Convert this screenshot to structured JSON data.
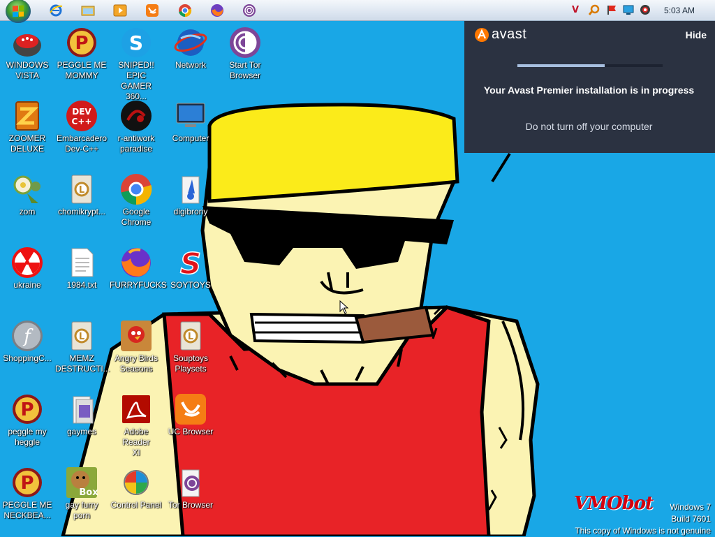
{
  "taskbar": {
    "clock": "5:03 AM",
    "pinned": [
      {
        "name": "internet-explorer-icon"
      },
      {
        "name": "windows-explorer-icon"
      },
      {
        "name": "media-player-icon"
      },
      {
        "name": "uc-browser-icon"
      },
      {
        "name": "chrome-icon"
      },
      {
        "name": "firefox-icon"
      },
      {
        "name": "tor-browser-icon"
      }
    ],
    "tray": [
      {
        "name": "v-tray-icon",
        "glyph": "V"
      },
      {
        "name": "search-tray-icon"
      },
      {
        "name": "flag-tray-icon"
      },
      {
        "name": "monitor-tray-icon"
      },
      {
        "name": "volume-tray-icon"
      }
    ]
  },
  "desktop": {
    "icons": [
      {
        "label": "WINDOWS\nVISTA",
        "icon": "vista-icon"
      },
      {
        "label": "PEGGLE ME\nMOMMY",
        "icon": "peggle-icon"
      },
      {
        "label": "SNIPED!! EPIC\nGAMER 360...",
        "icon": "skype-icon",
        "glyph": "S"
      },
      {
        "label": "Network",
        "icon": "network-icon"
      },
      {
        "label": "Start Tor\nBrowser",
        "icon": "tor-icon"
      },
      {
        "label": "ZOOMER\nDELUXE",
        "icon": "zoomer-icon"
      },
      {
        "label": "Embarcadero\nDev-C++",
        "icon": "devcpp-icon",
        "glyph": "DEV\nC++"
      },
      {
        "label": "r-antiwork\nparadise",
        "icon": "antiwork-icon"
      },
      {
        "label": "Computer",
        "icon": "computer-icon"
      },
      {
        "label": "zom",
        "icon": "zom-icon"
      },
      {
        "label": "chomikrypt...",
        "icon": "shortcut-icon",
        "glyph": "L"
      },
      {
        "label": "Google\nChrome",
        "icon": "chrome-icon"
      },
      {
        "label": "digibrony",
        "icon": "digibrony-icon"
      },
      {
        "label": "ukraine",
        "icon": "radiation-icon"
      },
      {
        "label": "1984.txt",
        "icon": "text-file-icon"
      },
      {
        "label": "FURRYFUCKS",
        "icon": "firefox-icon"
      },
      {
        "label": "SOYTOYS",
        "icon": "soytoys-icon",
        "glyph": "S"
      },
      {
        "label": "ShoppingC...",
        "icon": "flash-icon",
        "glyph": "f"
      },
      {
        "label": "MEMZ\nDESTRUCTI...",
        "icon": "shortcut-icon",
        "glyph": "L"
      },
      {
        "label": "Angry Birds\nSeasons",
        "icon": "angry-birds-icon"
      },
      {
        "label": "Souptoys\nPlaysets",
        "icon": "shortcut-icon",
        "glyph": "L"
      },
      {
        "label": "peggle my\nheggle",
        "icon": "peggle-icon"
      },
      {
        "label": "gaymes",
        "icon": "folder-icon"
      },
      {
        "label": "Adobe Reader\nXI",
        "icon": "adobe-reader-icon"
      },
      {
        "label": "UC Browser",
        "icon": "uc-browser-icon"
      },
      {
        "label": "PEGGLE ME\nNECKBEA...",
        "icon": "peggle-icon"
      },
      {
        "label": "gay furry\nporn",
        "icon": "box-icon",
        "glyph": "Box"
      },
      {
        "label": "Control Panel",
        "icon": "control-panel-icon"
      },
      {
        "label": "Tor Browser",
        "icon": "tor-folder-icon"
      }
    ]
  },
  "avast": {
    "brand": "avast",
    "hide_label": "Hide",
    "progress": 0.6,
    "message": "Your Avast Premier installation is in progress",
    "submessage": "Do not turn off your computer",
    "colors": {
      "background": "#2b3241",
      "accent": "#ff7800",
      "bar": "#a7bfdf"
    }
  },
  "watermark": {
    "logo": "VMObot",
    "line1": "Windows 7",
    "line2": "Build 7601",
    "line3": "This copy of Windows is not genuine"
  },
  "colors": {
    "desktop": "#19a7e6",
    "taskbar": "#dfe8f2"
  }
}
